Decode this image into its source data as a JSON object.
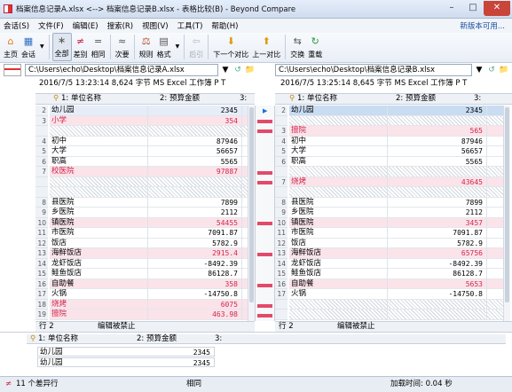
{
  "window": {
    "title": "档案信息记录A.xlsx <--> 档案信息记录B.xlsx - 表格比较(B) - Beyond Compare"
  },
  "menu": {
    "items": [
      "会话(S)",
      "文件(F)",
      "编辑(E)",
      "搜索(R)",
      "视图(V)",
      "工具(T)",
      "帮助(H)"
    ],
    "right_link": "新版本可用..."
  },
  "toolbar": {
    "home": "主页",
    "session": "会话",
    "all": "全部",
    "diffs": "差别",
    "same": "相同",
    "minor": "次要",
    "rules": "规则",
    "format": "格式",
    "prev_dis": "后引",
    "next_diff": "下一个对比",
    "prev_diff": "上一对比",
    "swap": "交换",
    "reload": "重载"
  },
  "left": {
    "path": "C:\\Users\\echo\\Desktop\\档案信息记录A.xlsx",
    "info": "2016/7/5 13:23:14    8,624 字节    MS Excel 工作簿        P  T",
    "col1": "1: 单位名称",
    "col2": "2: 预算金额",
    "col3": "3:",
    "rows": [
      {
        "n": "2",
        "name": "幼儿园",
        "val": "2345",
        "cls": "bg-blue"
      },
      {
        "n": "3",
        "name": "小学",
        "val": "354",
        "cls": "bg-pink",
        "diff": true
      },
      {
        "n": "",
        "name": "",
        "val": "",
        "cls": "hatch"
      },
      {
        "n": "4",
        "name": "初中",
        "val": "87946",
        "cls": ""
      },
      {
        "n": "5",
        "name": "大学",
        "val": "56657",
        "cls": ""
      },
      {
        "n": "6",
        "name": "职高",
        "val": "5565",
        "cls": ""
      },
      {
        "n": "7",
        "name": "校医院",
        "val": "97887",
        "cls": "bg-pink",
        "diff": true
      },
      {
        "n": "",
        "name": "",
        "val": "",
        "cls": "hatch"
      },
      {
        "n": "",
        "name": "",
        "val": "",
        "cls": "hatch"
      },
      {
        "n": "8",
        "name": "县医院",
        "val": "7899",
        "cls": ""
      },
      {
        "n": "9",
        "name": "乡医院",
        "val": "2112",
        "cls": ""
      },
      {
        "n": "10",
        "name": "镇医院",
        "val": "54455",
        "cls": "bg-pink",
        "diff_val": true
      },
      {
        "n": "11",
        "name": "市医院",
        "val": "7091.87",
        "cls": ""
      },
      {
        "n": "12",
        "name": "饭店",
        "val": "5782.9",
        "cls": ""
      },
      {
        "n": "13",
        "name": "海鲜饭店",
        "val": "2915.4",
        "cls": "bg-pink",
        "diff_val": true
      },
      {
        "n": "14",
        "name": "龙虾饭店",
        "val": "-8492.39",
        "cls": ""
      },
      {
        "n": "15",
        "name": "鲑鱼饭店",
        "val": "86128.7",
        "cls": ""
      },
      {
        "n": "16",
        "name": "自助餐",
        "val": "358",
        "cls": "bg-pink",
        "diff_val": true
      },
      {
        "n": "17",
        "name": "火锅",
        "val": "-14750.8",
        "cls": ""
      },
      {
        "n": "18",
        "name": "烧烤",
        "val": "6075",
        "cls": "bg-pink",
        "diff": true
      },
      {
        "n": "19",
        "name": "擅院",
        "val": "463.98",
        "cls": "bg-pink",
        "diff": true
      }
    ],
    "status_row": "行 2",
    "status_mode": "编辑被禁止"
  },
  "right": {
    "path": "C:\\Users\\echo\\Desktop\\档案信息记录B.xlsx",
    "info": "2016/7/5 13:25:14    8,645 字节    MS Excel 工作簿        P  T",
    "col1": "1: 单位名称",
    "col2": "2: 预算金额",
    "col3": "3:",
    "rows": [
      {
        "n": "2",
        "name": "幼儿园",
        "val": "2345",
        "cls": "bg-sel"
      },
      {
        "n": "",
        "name": "",
        "val": "",
        "cls": "hatch"
      },
      {
        "n": "3",
        "name": "擅院",
        "val": "565",
        "cls": "bg-pink",
        "diff": true
      },
      {
        "n": "4",
        "name": "初中",
        "val": "87946",
        "cls": ""
      },
      {
        "n": "5",
        "name": "大学",
        "val": "56657",
        "cls": ""
      },
      {
        "n": "6",
        "name": "职高",
        "val": "5565",
        "cls": ""
      },
      {
        "n": "",
        "name": "",
        "val": "",
        "cls": "hatch"
      },
      {
        "n": "7",
        "name": "烧烤",
        "val": "43645",
        "cls": "bg-pink",
        "diff": true
      },
      {
        "n": "",
        "name": "",
        "val": "",
        "cls": "hatch"
      },
      {
        "n": "8",
        "name": "县医院",
        "val": "7899",
        "cls": ""
      },
      {
        "n": "9",
        "name": "乡医院",
        "val": "2112",
        "cls": ""
      },
      {
        "n": "10",
        "name": "镇医院",
        "val": "3457",
        "cls": "bg-pink",
        "diff_val": true
      },
      {
        "n": "11",
        "name": "市医院",
        "val": "7091.87",
        "cls": ""
      },
      {
        "n": "12",
        "name": "饭店",
        "val": "5782.9",
        "cls": ""
      },
      {
        "n": "13",
        "name": "海鲜饭店",
        "val": "65756",
        "cls": "bg-pink",
        "diff_val": true
      },
      {
        "n": "14",
        "name": "龙虾饭店",
        "val": "-8492.39",
        "cls": ""
      },
      {
        "n": "15",
        "name": "鲑鱼饭店",
        "val": "86128.7",
        "cls": ""
      },
      {
        "n": "16",
        "name": "自助餐",
        "val": "5653",
        "cls": "bg-pink",
        "diff_val": true
      },
      {
        "n": "17",
        "name": "火锅",
        "val": "-14750.8",
        "cls": ""
      },
      {
        "n": "",
        "name": "",
        "val": "",
        "cls": "hatch"
      },
      {
        "n": "",
        "name": "",
        "val": "",
        "cls": "hatch"
      }
    ],
    "status_row": "行 2",
    "status_mode": "编辑被禁止"
  },
  "detail": {
    "col1": "1: 单位名称",
    "col2": "2: 预算金额",
    "col3": "3:",
    "rows": [
      {
        "name": "幼儿园",
        "val": "2345"
      },
      {
        "name": "幼儿园",
        "val": "2345"
      }
    ]
  },
  "bottom": {
    "diff_count": "11 个差异行",
    "middle": "相同",
    "load_time": "加载时间: 0.04 秒"
  },
  "colors": {
    "diff": "#d0264a",
    "diff_bg": "#fbe3ea",
    "selected": "#c8dcf2"
  }
}
